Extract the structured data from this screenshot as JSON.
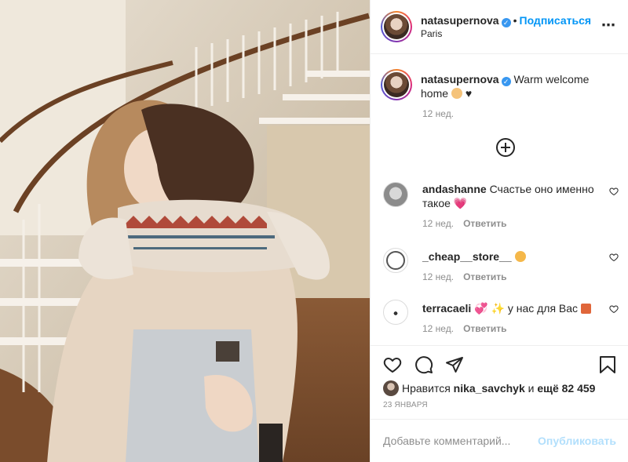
{
  "post": {
    "image_alt": "photo"
  },
  "header": {
    "username": "natasupernova",
    "follow_label": "Подписаться",
    "dot": "•",
    "location": "Paris",
    "more_icon": "more-horizontal-icon"
  },
  "caption": {
    "username": "natasupernova",
    "text": "Warm welcome home",
    "emoji_after": "♥",
    "time": "12 нед."
  },
  "comments": [
    {
      "username": "andashanne",
      "text": "Счастье оно именно такое",
      "time": "12 нед.",
      "reply": "Ответить"
    },
    {
      "username": "_cheap__store__",
      "text": "",
      "time": "12 нед.",
      "reply": "Ответить"
    },
    {
      "username": "terracaeli",
      "text": "у нас для Вас",
      "time": "12 нед.",
      "reply": "Ответить"
    }
  ],
  "likes": {
    "prefix": "Нравится ",
    "user": "nika_savchyk",
    "middle": " и ",
    "count": "ещё 82 459"
  },
  "date": "23 ЯНВАРЯ",
  "add_comment": {
    "placeholder": "Добавьте комментарий...",
    "publish": "Опубликовать"
  },
  "colors": {
    "link": "#0095f6",
    "muted": "#8e8e8e",
    "verified": "#3897f0"
  }
}
